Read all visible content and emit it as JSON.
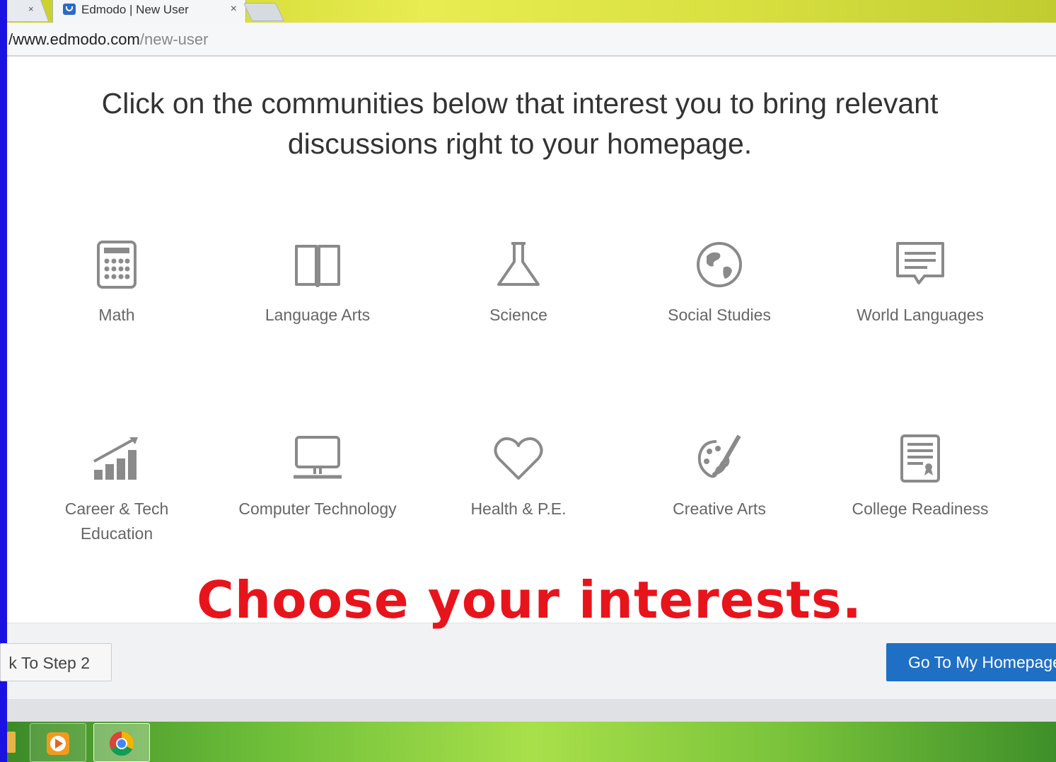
{
  "browser": {
    "prev_tab_close": "×",
    "active_tab": {
      "title": "Edmodo | New User",
      "close": "×"
    },
    "address": {
      "host": "/www.edmodo.com",
      "path": "/new-user"
    }
  },
  "page": {
    "heading_line1": "Click on the communities below that interest you to bring relevant",
    "heading_line2": "discussions right to your homepage.",
    "communities": [
      {
        "label": "Math",
        "icon": "calculator-icon"
      },
      {
        "label": "Language Arts",
        "icon": "book-icon"
      },
      {
        "label": "Science",
        "icon": "flask-icon"
      },
      {
        "label": "Social Studies",
        "icon": "globe-icon"
      },
      {
        "label": "World Languages",
        "icon": "speech-bubble-icon"
      },
      {
        "label": "Career & Tech Education",
        "label_line1": "Career & Tech",
        "label_line2": "Education",
        "icon": "bar-chart-icon"
      },
      {
        "label": "Computer Technology",
        "icon": "monitor-icon"
      },
      {
        "label": "Health & P.E.",
        "icon": "heart-icon"
      },
      {
        "label": "Creative Arts",
        "icon": "palette-icon"
      },
      {
        "label": "College Readiness",
        "icon": "certificate-icon"
      }
    ],
    "annotation": "Choose your interests.",
    "back_button": "k To Step 2",
    "home_button": "Go To My Homepage"
  },
  "colors": {
    "annotation": "#e8141c",
    "primary_button": "#1f6fc5",
    "icon_gray": "#8a8a8a",
    "frame": "#1a12e0"
  },
  "taskbar": {
    "items": [
      "media-player-icon",
      "chrome-icon"
    ]
  }
}
